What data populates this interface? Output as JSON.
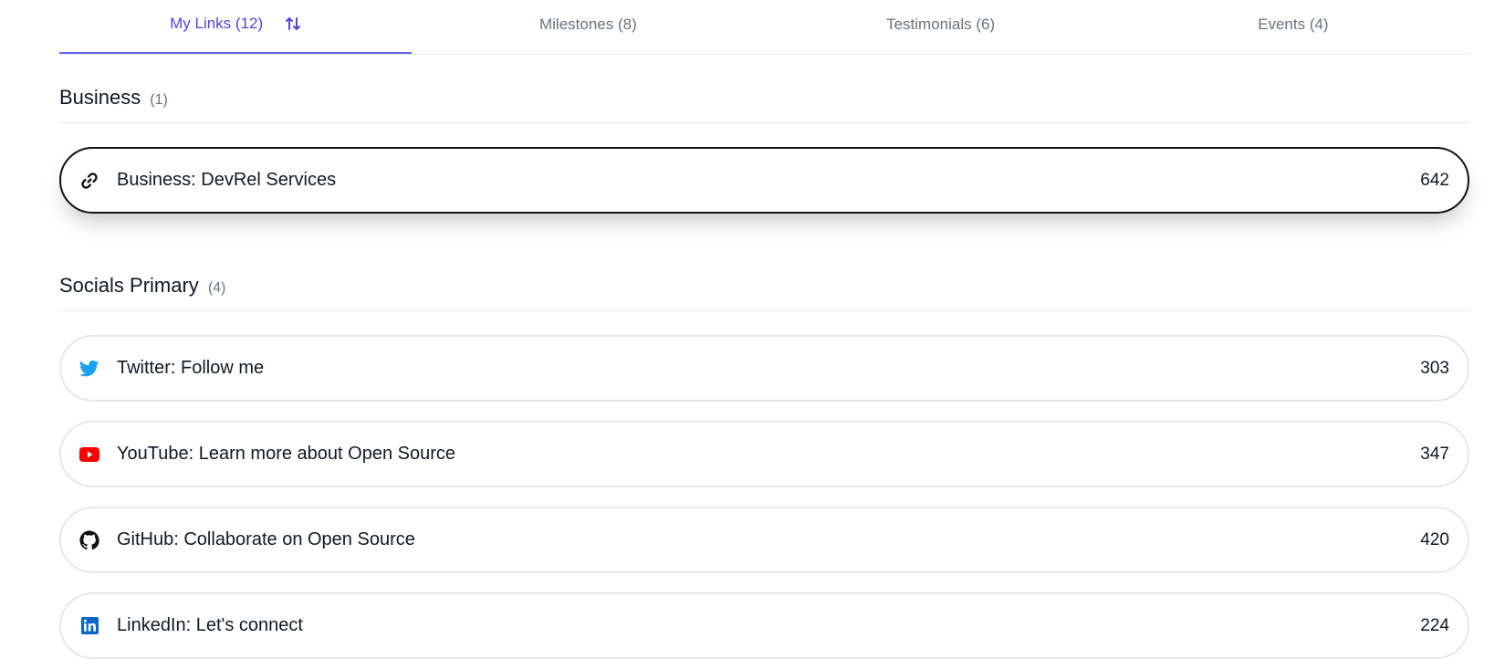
{
  "tabs": [
    {
      "label": "My Links (12)",
      "active": true,
      "icon": "sort-arrows-icon"
    },
    {
      "label": "Milestones (8)",
      "active": false
    },
    {
      "label": "Testimonials (6)",
      "active": false
    },
    {
      "label": "Events (4)",
      "active": false
    }
  ],
  "sections": [
    {
      "title": "Business",
      "count": "(1)",
      "links": [
        {
          "icon": "link-icon",
          "label": "Business: DevRel Services",
          "clicks": "642",
          "highlighted": true
        }
      ]
    },
    {
      "title": "Socials Primary",
      "count": "(4)",
      "links": [
        {
          "icon": "twitter-icon",
          "label": "Twitter: Follow me",
          "clicks": "303"
        },
        {
          "icon": "youtube-icon",
          "label": "YouTube: Learn more about Open Source",
          "clicks": "347"
        },
        {
          "icon": "github-icon",
          "label": "GitHub: Collaborate on Open Source",
          "clicks": "420"
        },
        {
          "icon": "linkedin-icon",
          "label": "LinkedIn: Let's connect",
          "clicks": "224"
        }
      ]
    }
  ],
  "colors": {
    "accent": "#4f46e5",
    "tab_underline": "#6366f1",
    "twitter": "#1da1f2",
    "youtube": "#ff0000",
    "linkedin": "#0a66c2"
  }
}
